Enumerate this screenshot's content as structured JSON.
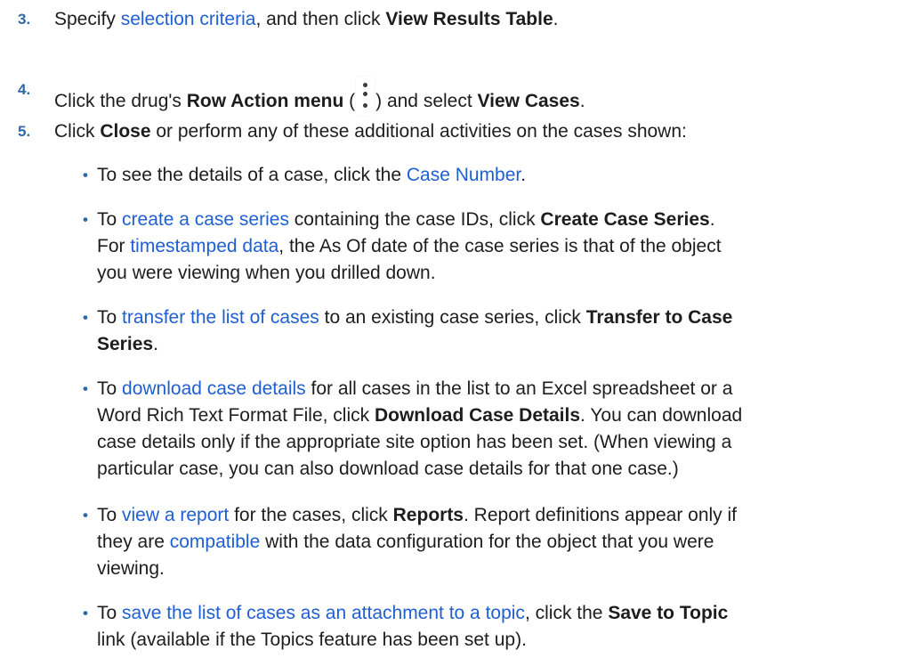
{
  "bullet_glyph": "•",
  "steps": [
    {
      "number": "3.",
      "t1": "Specify ",
      "link": "selection criteria",
      "t2": ", and then click ",
      "bold": "View Results Table",
      "t3": "."
    },
    {
      "number": "4.",
      "t1": "Click the drug's ",
      "bold1": "Row Action menu",
      "t2": " (",
      "icon": "vertical-ellipsis-icon",
      "t3": ") and select ",
      "bold2": "View Cases",
      "t4": "."
    },
    {
      "number": "5.",
      "t1": "Click ",
      "bold": "Close",
      "t2": " or perform any of these additional activities on the cases shown:"
    }
  ],
  "bullets": {
    "case_number": {
      "t1": "To see the details of a case, click the ",
      "link": "Case Number",
      "t2": "."
    },
    "create_series": {
      "l1_t1": "To ",
      "l1_link": "create a case series",
      "l1_t2": " containing the case IDs, click ",
      "l1_bold": "Create Case Series",
      "l1_t3": ".",
      "l2_t1": "For ",
      "l2_link": "timestamped data",
      "l2_t2": ", the As Of date of the case series is that of the object",
      "l3": "you were viewing when you drilled down."
    },
    "transfer": {
      "l1_t1": "To ",
      "l1_link": "transfer the list of cases",
      "l1_t2": " to an existing case series, click ",
      "l1_bold": "Transfer to Case",
      "l2_bold": "Series",
      "l2_t1": "."
    },
    "download": {
      "l1_t1": "To ",
      "l1_link": "download case details",
      "l1_t2": " for all cases in the list to an Excel spreadsheet or a",
      "l2_t1": "Word Rich Text Format File, click ",
      "l2_bold": "Download Case Details",
      "l2_t2": ". You can download",
      "l3": "case details only if the appropriate site option has been set. (When viewing a",
      "l4": "particular case, you can also download case details for that one case.)"
    },
    "report": {
      "l1_t1": "To ",
      "l1_link": "view a report",
      "l1_t2": " for the cases, click ",
      "l1_bold": "Reports",
      "l1_t3": ". Report definitions appear only if",
      "l2_t1": "they are ",
      "l2_link": "compatible",
      "l2_t2": " with the data configuration for the object that you were",
      "l3": "viewing."
    },
    "topic": {
      "l1_t1": "To ",
      "l1_link": "save the list of cases as an attachment to a topic",
      "l1_t2": ", click the ",
      "l1_bold": "Save to Topic",
      "l2": "link (available if the Topics feature has been set up)."
    }
  }
}
